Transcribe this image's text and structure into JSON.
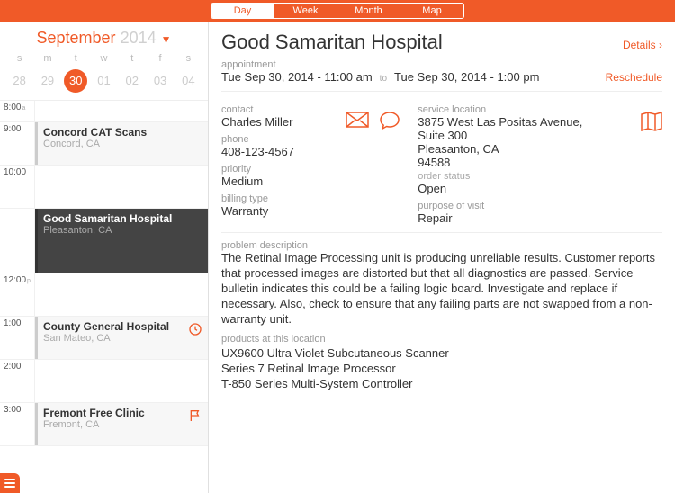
{
  "topbar": {
    "tabs": [
      "Day",
      "Week",
      "Month",
      "Map"
    ],
    "active": 0
  },
  "calendar": {
    "month": "September",
    "year": "2014",
    "dow": [
      "s",
      "m",
      "t",
      "w",
      "t",
      "f",
      "s"
    ],
    "dates": [
      "28",
      "29",
      "30",
      "01",
      "02",
      "03",
      "04"
    ],
    "selected_index": 2
  },
  "timeline": {
    "slots": [
      {
        "time": "8:00",
        "ampm": "a"
      },
      {
        "time": "9:00",
        "event": {
          "title": "Concord CAT Scans",
          "loc": "Concord, CA",
          "style": "light"
        }
      },
      {
        "time": "10:00"
      },
      {
        "time": "",
        "event": {
          "title": "Good Samaritan Hospital",
          "loc": "Pleasanton, CA",
          "style": "dark",
          "tall": true
        }
      },
      {
        "time": "12:00",
        "ampm": "p"
      },
      {
        "time": "1:00",
        "event": {
          "title": "County General Hospital",
          "loc": "San Mateo, CA",
          "style": "light",
          "icon": "clock"
        }
      },
      {
        "time": "2:00"
      },
      {
        "time": "3:00",
        "event": {
          "title": "Fremont Free Clinic",
          "loc": "Fremont, CA",
          "style": "light",
          "icon": "flag"
        }
      }
    ]
  },
  "detail": {
    "title": "Good Samaritan Hospital",
    "details_link": "Details",
    "appointment_label": "appointment",
    "start": "Tue Sep 30, 2014 - 11:00 am",
    "to": "to",
    "end": "Tue Sep 30, 2014 - 1:00 pm",
    "reschedule": "Reschedule",
    "contact_label": "contact",
    "contact": "Charles Miller",
    "phone_label": "phone",
    "phone": "408-123-4567",
    "priority_label": "priority",
    "priority": "Medium",
    "billing_label": "billing type",
    "billing": "Warranty",
    "service_loc_label": "service location",
    "address1": "3875 West Las Positas Avenue,",
    "address2": "Suite 300",
    "address3": "Pleasanton, CA",
    "address4": "94588",
    "order_status_label": "order status",
    "order_status": "Open",
    "purpose_label": "purpose of visit",
    "purpose": "Repair",
    "problem_label": "problem description",
    "problem": "The Retinal Image Processing unit is producing unreliable results. Customer reports that processed images are distorted but that all diagnostics are passed. Service bulletin indicates this could be a failing logic board. Investigate and replace if necessary. Also, check to ensure that any failing parts are not swapped from a non-warranty unit.",
    "products_label": "products at this location",
    "products": [
      "UX9600 Ultra Violet Subcutaneous Scanner",
      "Series 7 Retinal Image Processor",
      "T-850 Series Multi-System Controller"
    ]
  }
}
